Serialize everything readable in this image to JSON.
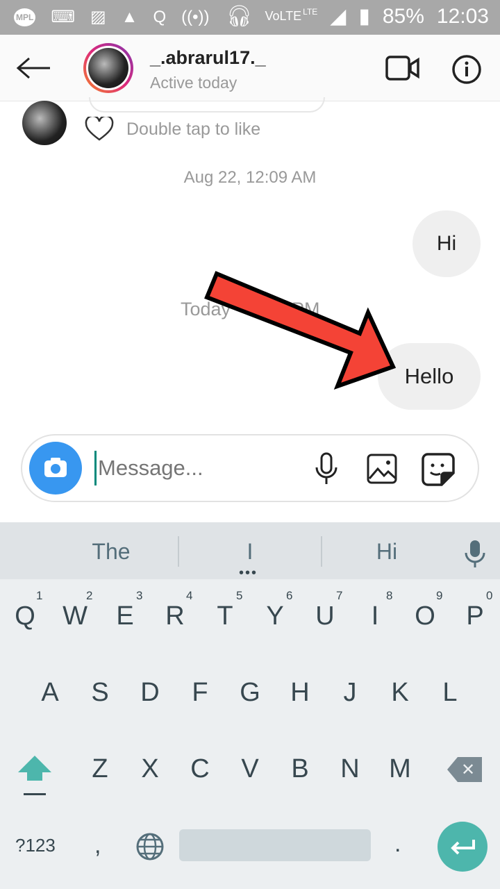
{
  "status_bar": {
    "battery": "85%",
    "time": "12:03",
    "network": "VoLTE",
    "lte": "LTE",
    "logo": "MPL"
  },
  "header": {
    "username": "_.abrarul17._",
    "status": "Active today"
  },
  "chat": {
    "like_hint": "Double tap to like",
    "timestamp1": "Aug 22, 12:09 AM",
    "timestamp2_start": "Today",
    "timestamp2_end": "PM",
    "messages": [
      {
        "text": "Hi",
        "sent": true
      },
      {
        "text": "Hello",
        "sent": true
      }
    ]
  },
  "composer": {
    "placeholder": "Message..."
  },
  "keyboard": {
    "suggestions": [
      "The",
      "I",
      "Hi"
    ],
    "row1": [
      "Q",
      "W",
      "E",
      "R",
      "T",
      "Y",
      "U",
      "I",
      "O",
      "P"
    ],
    "row1_nums": [
      "1",
      "2",
      "3",
      "4",
      "5",
      "6",
      "7",
      "8",
      "9",
      "0"
    ],
    "row2": [
      "A",
      "S",
      "D",
      "F",
      "G",
      "H",
      "J",
      "K",
      "L"
    ],
    "row3": [
      "Z",
      "X",
      "C",
      "V",
      "B",
      "N",
      "M"
    ],
    "sym": "?123",
    "comma": ",",
    "period": "."
  },
  "colors": {
    "arrow": "#f44336",
    "enter": "#4db6ac",
    "camera": "#3897f0"
  }
}
